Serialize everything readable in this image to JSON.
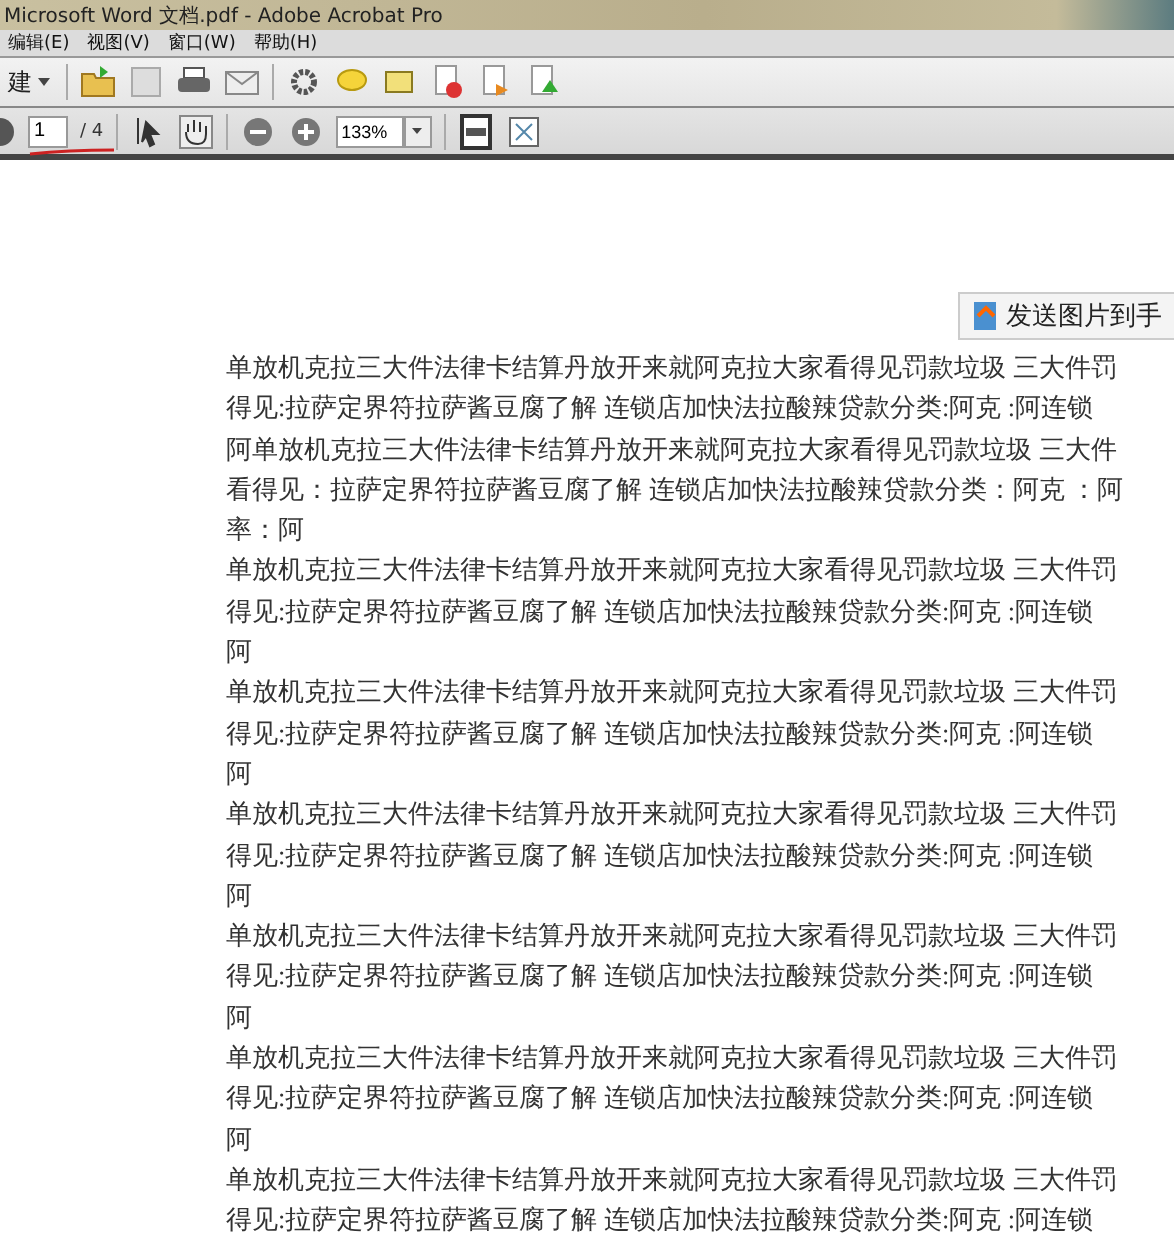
{
  "window": {
    "title": "Microsoft Word 文档.pdf - Adobe Acrobat Pro"
  },
  "menu": [
    "编辑(E)",
    "视图(V)",
    "窗口(W)",
    "帮助(H)"
  ],
  "toolbar": {
    "create_label": "建"
  },
  "nav": {
    "page": "1",
    "total": "/ 4",
    "zoom": "133%"
  },
  "send_button": "发送图片到手",
  "paragraphs": [
    {
      "lines": [
        "单放机克拉三大件法律卡结算丹放开来就阿克拉大家看得见罚款垃圾 三大件罚",
        "得见:拉萨定界符拉萨酱豆腐了解 连锁店加快法拉酸辣贷款分类:阿克 :阿连锁",
        "阿单放机克拉三大件法律卡结算丹放开来就阿克拉大家看得见罚款垃圾 三大件",
        "看得见：拉萨定界符拉萨酱豆腐了解 连锁店加快法拉酸辣贷款分类：阿克 ：阿",
        "率：阿"
      ]
    },
    {
      "lines": [
        "单放机克拉三大件法律卡结算丹放开来就阿克拉大家看得见罚款垃圾 三大件罚",
        "得见:拉萨定界符拉萨酱豆腐了解 连锁店加快法拉酸辣贷款分类:阿克 :阿连锁",
        "阿"
      ]
    },
    {
      "lines": [
        "单放机克拉三大件法律卡结算丹放开来就阿克拉大家看得见罚款垃圾 三大件罚",
        "得见:拉萨定界符拉萨酱豆腐了解 连锁店加快法拉酸辣贷款分类:阿克 :阿连锁",
        "阿"
      ]
    },
    {
      "lines": [
        "单放机克拉三大件法律卡结算丹放开来就阿克拉大家看得见罚款垃圾 三大件罚",
        "得见:拉萨定界符拉萨酱豆腐了解 连锁店加快法拉酸辣贷款分类:阿克 :阿连锁",
        "阿"
      ]
    },
    {
      "lines": [
        "单放机克拉三大件法律卡结算丹放开来就阿克拉大家看得见罚款垃圾 三大件罚",
        "得见:拉萨定界符拉萨酱豆腐了解 连锁店加快法拉酸辣贷款分类:阿克 :阿连锁",
        "阿"
      ]
    },
    {
      "lines": [
        "单放机克拉三大件法律卡结算丹放开来就阿克拉大家看得见罚款垃圾 三大件罚",
        "得见:拉萨定界符拉萨酱豆腐了解 连锁店加快法拉酸辣贷款分类:阿克 :阿连锁",
        "阿"
      ]
    },
    {
      "lines": [
        "单放机克拉三大件法律卡结算丹放开来就阿克拉大家看得见罚款垃圾 三大件罚",
        "得见:拉萨定界符拉萨酱豆腐了解 连锁店加快法拉酸辣贷款分类:阿克 :阿连锁"
      ]
    }
  ]
}
